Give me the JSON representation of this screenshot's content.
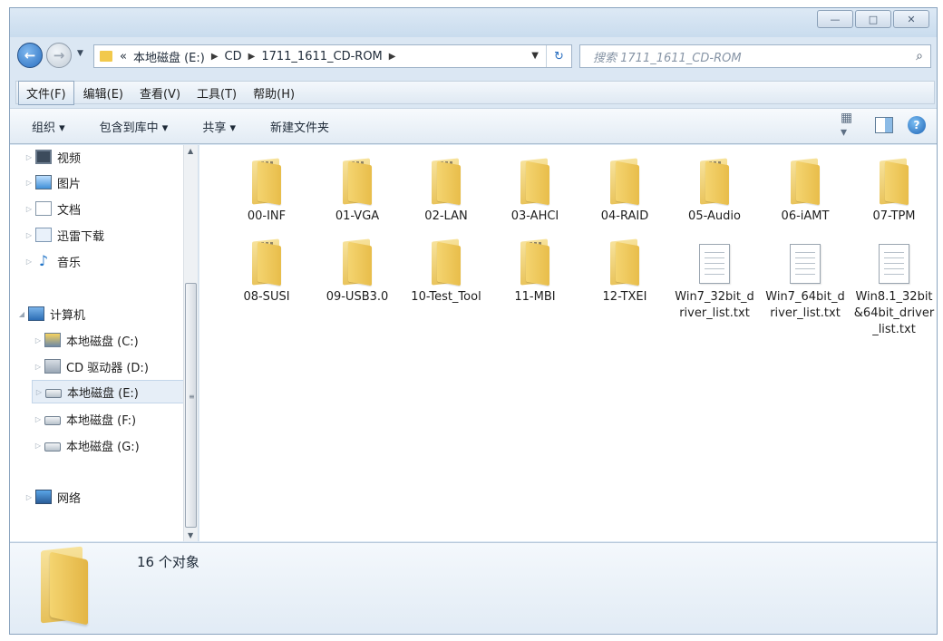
{
  "window": {
    "controls": {
      "minimize": "—",
      "maximize": "□",
      "close": "✕"
    }
  },
  "address": {
    "chevrons": "«",
    "crumbs": [
      "本地磁盘 (E:)",
      "CD",
      "1711_1611_CD-ROM"
    ],
    "search_placeholder": "搜索 1711_1611_CD-ROM"
  },
  "menu": [
    "文件(F)",
    "编辑(E)",
    "查看(V)",
    "工具(T)",
    "帮助(H)"
  ],
  "commands": [
    "组织 ▾",
    "包含到库中 ▾",
    "共享 ▾",
    "新建文件夹"
  ],
  "sidebar": {
    "items": [
      {
        "label": "视频",
        "icon": "video-icon"
      },
      {
        "label": "图片",
        "icon": "picture-icon"
      },
      {
        "label": "文档",
        "icon": "document-icon"
      },
      {
        "label": "迅雷下载",
        "icon": "thunder-download-icon"
      },
      {
        "label": "音乐",
        "icon": "music-icon"
      },
      {
        "label": "计算机",
        "icon": "computer-icon"
      },
      {
        "label": "本地磁盘 (C:)",
        "icon": "drive-c-icon"
      },
      {
        "label": "CD 驱动器 (D:)",
        "icon": "cd-drive-icon"
      },
      {
        "label": "本地磁盘 (E:)",
        "icon": "drive-icon",
        "selected": true
      },
      {
        "label": "本地磁盘 (F:)",
        "icon": "drive-icon"
      },
      {
        "label": "本地磁盘 (G:)",
        "icon": "drive-icon"
      },
      {
        "label": "网络",
        "icon": "network-icon"
      }
    ]
  },
  "files": [
    {
      "name": "00-INF",
      "type": "folder-papers"
    },
    {
      "name": "01-VGA",
      "type": "folder-papers"
    },
    {
      "name": "02-LAN",
      "type": "folder-papers"
    },
    {
      "name": "03-AHCI",
      "type": "folder"
    },
    {
      "name": "04-RAID",
      "type": "folder"
    },
    {
      "name": "05-Audio",
      "type": "folder-papers"
    },
    {
      "name": "06-iAMT",
      "type": "folder"
    },
    {
      "name": "07-TPM",
      "type": "folder"
    },
    {
      "name": "08-SUSI",
      "type": "folder-papers"
    },
    {
      "name": "09-USB3.0",
      "type": "folder"
    },
    {
      "name": "10-Test_Tool",
      "type": "folder"
    },
    {
      "name": "11-MBI",
      "type": "folder-papers"
    },
    {
      "name": "12-TXEI",
      "type": "folder"
    },
    {
      "name": "Win7_32bit_driver_list.txt",
      "type": "txt"
    },
    {
      "name": "Win7_64bit_driver_list.txt",
      "type": "txt"
    },
    {
      "name": "Win8.1_32bit&64bit_driver_list.txt",
      "type": "txt"
    }
  ],
  "details": {
    "count": "16 个对象"
  },
  "colors": {
    "folder": "#f0cc5c",
    "window_frame": "#dbe7f3",
    "selection": "#e6eef7"
  }
}
